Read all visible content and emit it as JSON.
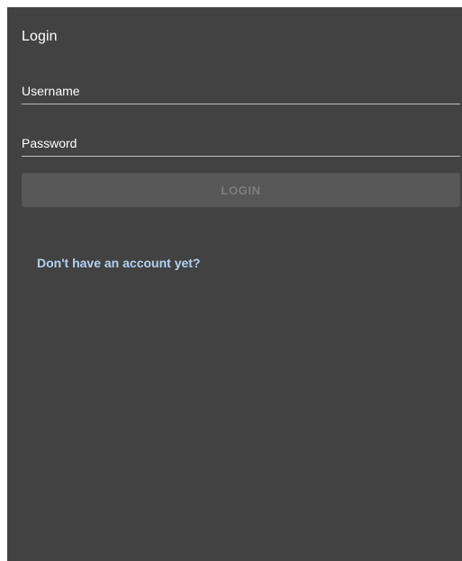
{
  "login_form": {
    "title": "Login",
    "username_placeholder": "Username",
    "username_value": "",
    "password_placeholder": "Password",
    "password_value": "",
    "login_button_label": "LOGIN",
    "login_button_state": "disabled",
    "signup_link_text": "Don't have an account yet?"
  },
  "colors": {
    "panel_background": "#424242",
    "page_background": "#ffffff",
    "text_primary": "#ffffff",
    "field_underline": "#bdbdbd",
    "button_disabled_background": "#575757",
    "button_disabled_text": "#7e7e7e",
    "link": "#b3d2f0"
  }
}
